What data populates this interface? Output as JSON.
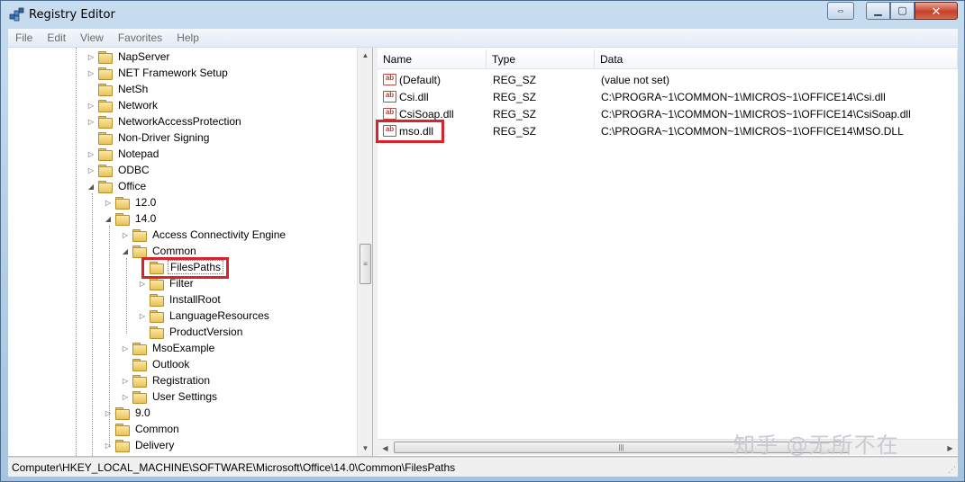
{
  "window": {
    "title": "Registry Editor",
    "restore_extra_icon": "double-arrow-icon",
    "min_glyph": "▁",
    "max_glyph": "▢",
    "close_glyph": "✕"
  },
  "menu": [
    "File",
    "Edit",
    "View",
    "Favorites",
    "Help"
  ],
  "tree": [
    {
      "label": "NapServer",
      "expandable": true
    },
    {
      "label": "NET Framework Setup",
      "expandable": true
    },
    {
      "label": "NetSh",
      "expandable": false
    },
    {
      "label": "Network",
      "expandable": true
    },
    {
      "label": "NetworkAccessProtection",
      "expandable": true
    },
    {
      "label": "Non-Driver Signing",
      "expandable": false
    },
    {
      "label": "Notepad",
      "expandable": true
    },
    {
      "label": "ODBC",
      "expandable": true
    },
    {
      "label": "Office",
      "expandable": true
    },
    {
      "label": "12.0",
      "expandable": true
    },
    {
      "label": "14.0",
      "expandable": true
    },
    {
      "label": "Access Connectivity Engine",
      "expandable": true
    },
    {
      "label": "Common",
      "expandable": true
    },
    {
      "label": "FilesPaths",
      "expandable": false
    },
    {
      "label": "Filter",
      "expandable": true
    },
    {
      "label": "InstallRoot",
      "expandable": false
    },
    {
      "label": "LanguageResources",
      "expandable": true
    },
    {
      "label": "ProductVersion",
      "expandable": false
    },
    {
      "label": "MsoExample",
      "expandable": true
    },
    {
      "label": "Outlook",
      "expandable": false
    },
    {
      "label": "Registration",
      "expandable": true
    },
    {
      "label": "User Settings",
      "expandable": true
    },
    {
      "label": "9.0",
      "expandable": true
    },
    {
      "label": "Common",
      "expandable": false
    },
    {
      "label": "Delivery",
      "expandable": true
    }
  ],
  "columns": {
    "name": "Name",
    "type": "Type",
    "data": "Data"
  },
  "values": [
    {
      "name": "(Default)",
      "type": "REG_SZ",
      "data": "(value not set)"
    },
    {
      "name": "Csi.dll",
      "type": "REG_SZ",
      "data": "C:\\PROGRA~1\\COMMON~1\\MICROS~1\\OFFICE14\\Csi.dll"
    },
    {
      "name": "CsiSoap.dll",
      "type": "REG_SZ",
      "data": "C:\\PROGRA~1\\COMMON~1\\MICROS~1\\OFFICE14\\CsiSoap.dll"
    },
    {
      "name": "mso.dll",
      "type": "REG_SZ",
      "data": "C:\\PROGRA~1\\COMMON~1\\MICROS~1\\OFFICE14\\MSO.DLL"
    }
  ],
  "value_icon_text": "ab",
  "status": "Computer\\HKEY_LOCAL_MACHINE\\SOFTWARE\\Microsoft\\Office\\14.0\\Common\\FilesPaths",
  "watermark": "知乎 @无所不在",
  "colors": {
    "highlight": "#d8232a",
    "folder": "#e8c25a"
  }
}
